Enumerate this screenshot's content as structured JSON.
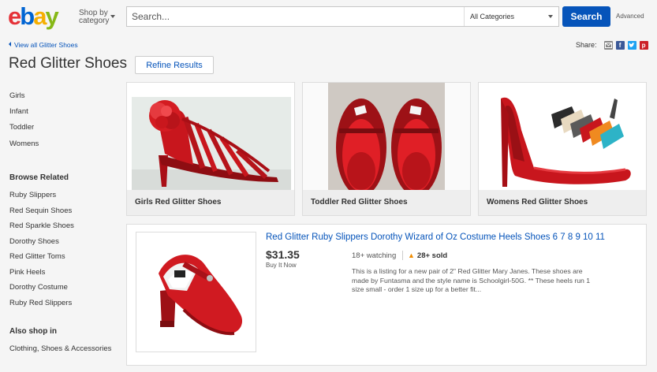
{
  "header": {
    "logo_text": "ebay",
    "shop_by_line1": "Shop by",
    "shop_by_line2": "category",
    "search_placeholder": "Search...",
    "category_select": "All Categories",
    "search_button": "Search",
    "advanced_link": "Advanced"
  },
  "breadcrumb": {
    "back_link": "View all Glitter Shoes"
  },
  "share": {
    "label": "Share:",
    "icons": [
      "email-icon",
      "facebook-icon",
      "twitter-icon",
      "pinterest-icon"
    ]
  },
  "page": {
    "title": "Red Glitter Shoes",
    "refine_button": "Refine Results"
  },
  "sidebar": {
    "categories": [
      "Girls",
      "Infant",
      "Toddler",
      "Womens"
    ],
    "browse_related_heading": "Browse Related",
    "browse_related": [
      "Ruby Slippers",
      "Red Sequin Shoes",
      "Red Sparkle Shoes",
      "Dorothy Shoes",
      "Red Glitter Toms",
      "Pink Heels",
      "Dorothy Costume",
      "Ruby Red Slippers"
    ],
    "also_shop_heading": "Also shop in",
    "also_shop": [
      "Clothing, Shoes & Accessories"
    ]
  },
  "cards": [
    {
      "caption": "Girls Red Glitter Shoes"
    },
    {
      "caption": "Toddler Red Glitter Shoes"
    },
    {
      "caption": "Womens Red Glitter Shoes"
    }
  ],
  "listing": {
    "title": "Red Glitter Ruby Slippers Dorothy Wizard of Oz Costume Heels Shoes 6 7 8 9 10 11",
    "price": "$31.35",
    "buy_format": "Buy It Now",
    "watching": "18+ watching",
    "sold": "28+ sold",
    "description": "This is a listing for a new pair of 2\" Red Glitter Mary Janes. These shoes are made by Funtasma and the style name is Schoolgirl-50G. ** These heels run 1 size small - order 1 size up for a better fit..."
  },
  "colors": {
    "brand_blue": "#0654ba",
    "logo_e": "#e53238",
    "logo_b": "#0064d2",
    "logo_a": "#f5af02",
    "logo_y": "#86b817",
    "shoe_red": "#c8161d"
  }
}
